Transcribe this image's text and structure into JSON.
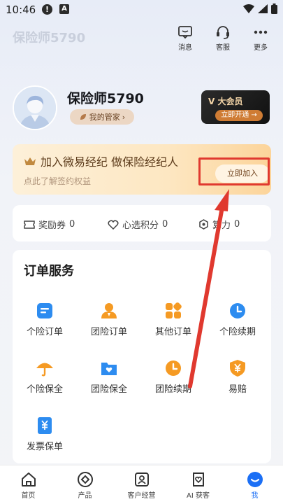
{
  "status": {
    "time": "10:46",
    "notif": "!",
    "a_icon": "A"
  },
  "header": {
    "ghost_title": "保险师5790",
    "actions": [
      {
        "label": "消息",
        "icon": "message-icon"
      },
      {
        "label": "客服",
        "icon": "headset-icon"
      },
      {
        "label": "更多",
        "icon": "more-icon"
      }
    ]
  },
  "profile": {
    "name": "保险师5790",
    "manager_label": "我的管家",
    "manager_arrow": "›"
  },
  "vip": {
    "title": "大会员",
    "button": "立即开通 →"
  },
  "banner": {
    "title": "加入微易经纪  做保险经纪人",
    "subtitle": "点此了解签约权益",
    "button": "立即加入"
  },
  "stats": [
    {
      "label": "奖励券",
      "value": "0",
      "icon": "coupon-icon"
    },
    {
      "label": "心选积分",
      "value": "0",
      "icon": "heart-icon"
    },
    {
      "label": "算力",
      "value": "0",
      "icon": "compute-icon"
    }
  ],
  "orders": {
    "title": "订单服务",
    "items": [
      {
        "label": "个险订单",
        "icon": "doc-icon"
      },
      {
        "label": "团险订单",
        "icon": "person-icon"
      },
      {
        "label": "其他订单",
        "icon": "grid-icon"
      },
      {
        "label": "个险续期",
        "icon": "clock-icon"
      },
      {
        "label": "个险保全",
        "icon": "umbrella-icon"
      },
      {
        "label": "团险保全",
        "icon": "folder-heart-icon"
      },
      {
        "label": "团险续期",
        "icon": "clock-icon"
      },
      {
        "label": "易赔",
        "icon": "shield-yen-icon"
      },
      {
        "label": "发票保单",
        "icon": "invoice-icon"
      }
    ]
  },
  "tabs": [
    {
      "label": "首页",
      "icon": "home-icon"
    },
    {
      "label": "产品",
      "icon": "product-icon"
    },
    {
      "label": "客户经营",
      "icon": "customer-icon"
    },
    {
      "label": "AI 获客",
      "icon": "ai-icon"
    },
    {
      "label": "我",
      "icon": "me-icon",
      "active": true
    }
  ],
  "colors": {
    "accent": "#1b6ff5",
    "order_blue": "#2d8cf0",
    "order_orange": "#f59a23",
    "highlight_red": "#e0392f"
  }
}
